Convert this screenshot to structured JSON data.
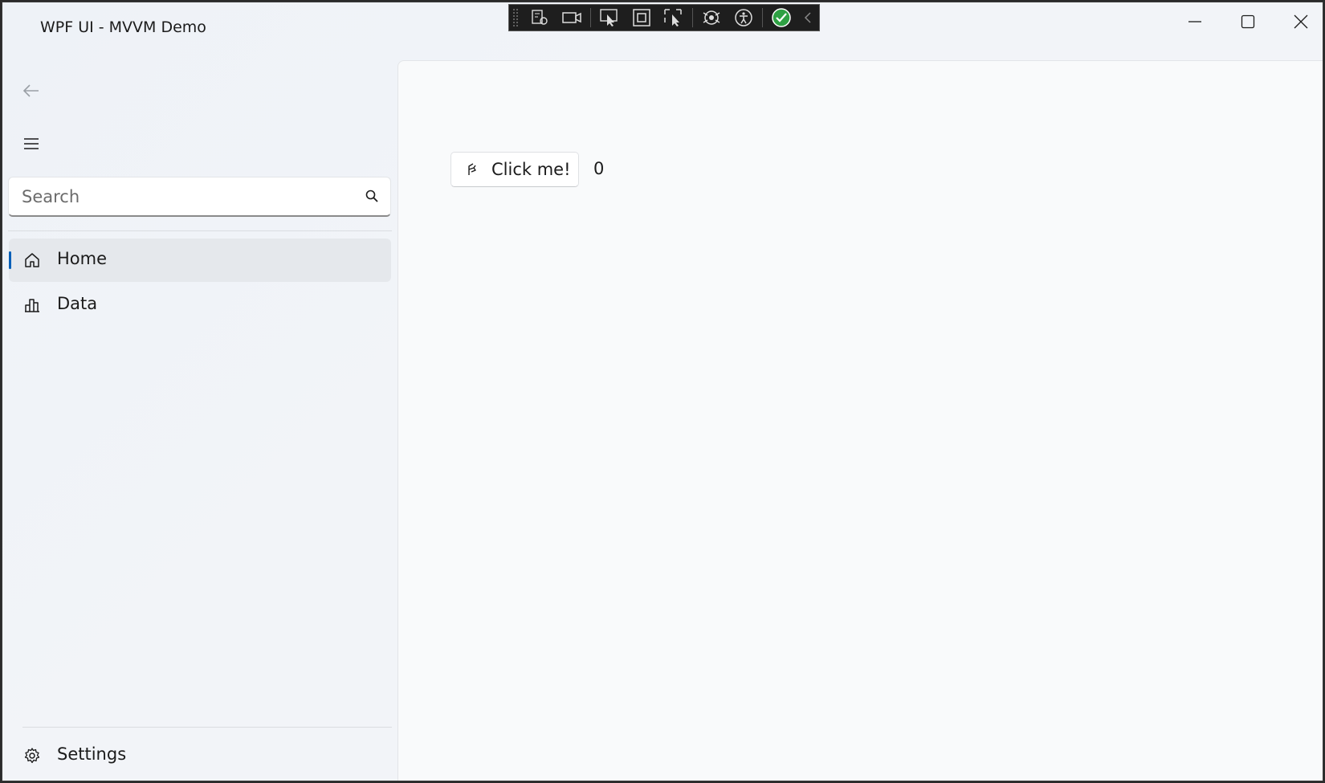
{
  "window": {
    "title": "WPF UI - MVVM Demo"
  },
  "title_bar_controls": {
    "minimize_icon": "minimize-icon",
    "maximize_icon": "maximize-icon",
    "close_icon": "close-icon"
  },
  "debug_toolbar": {
    "items": [
      "live-visual-tree-icon",
      "video-record-icon",
      "select-element-icon",
      "display-layout-adorners-icon",
      "track-focus-icon",
      "hot-reload-icon",
      "accessibility-icon",
      "binding-check-icon",
      "collapse-chevron-icon"
    ],
    "status_color": "#2ea043"
  },
  "sidebar": {
    "search": {
      "placeholder": "Search",
      "value": ""
    },
    "items": [
      {
        "label": "Home",
        "icon": "home-icon",
        "active": true
      },
      {
        "label": "Data",
        "icon": "bar-chart-icon",
        "active": false
      }
    ],
    "footer_items": [
      {
        "label": "Settings",
        "icon": "gear-icon"
      }
    ]
  },
  "main": {
    "button_label": "Click me!",
    "counter": "0"
  },
  "colors": {
    "accent": "#005fb8",
    "content_background": "#f9fafb",
    "sidebar_background": "#eef2f7"
  }
}
